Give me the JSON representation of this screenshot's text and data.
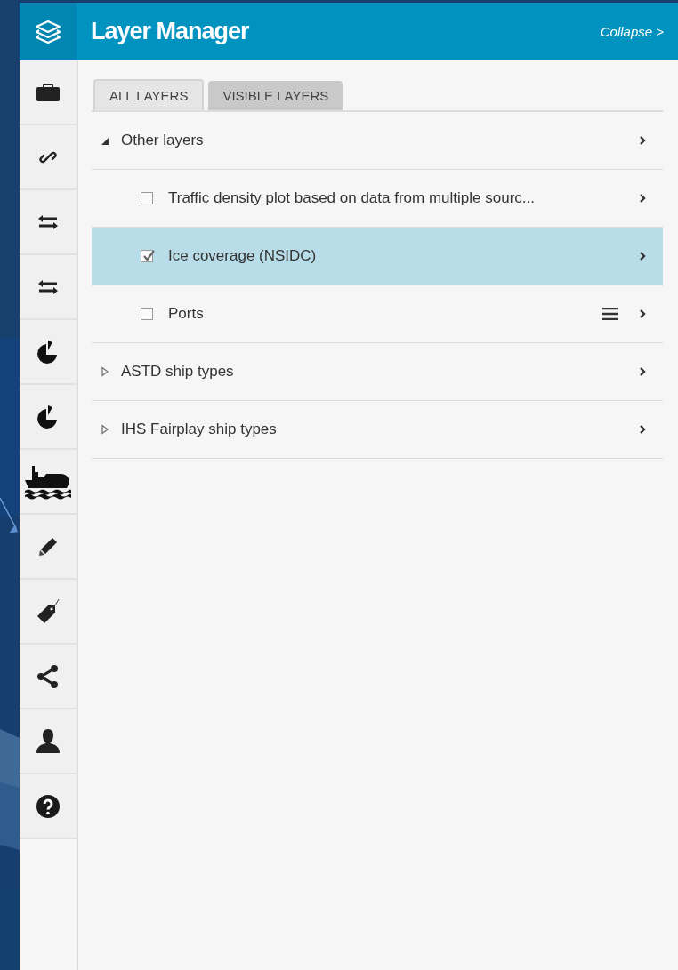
{
  "header": {
    "title": "Layer Manager",
    "collapse": "Collapse >"
  },
  "rail": [
    {
      "kind": "briefcase"
    },
    {
      "kind": "link"
    },
    {
      "kind": "swap"
    },
    {
      "kind": "swap"
    },
    {
      "kind": "pie"
    },
    {
      "kind": "pie"
    },
    {
      "kind": "ship"
    },
    {
      "kind": "pencil"
    },
    {
      "kind": "tag"
    },
    {
      "kind": "share"
    },
    {
      "kind": "person"
    },
    {
      "kind": "help"
    }
  ],
  "tabs": [
    {
      "label": "ALL LAYERS",
      "selected": true
    },
    {
      "label": "VISIBLE LAYERS",
      "selected": false
    }
  ],
  "tree": [
    {
      "label": "Other layers",
      "expanded": true,
      "children": [
        {
          "label": "Traffic density plot based on data from multiple sourc...",
          "checked": false,
          "selected": false,
          "menu": false
        },
        {
          "label": "Ice coverage (NSIDC)",
          "checked": true,
          "selected": true,
          "menu": false
        },
        {
          "label": "Ports",
          "checked": false,
          "selected": false,
          "menu": true
        }
      ]
    },
    {
      "label": "ASTD ship types",
      "expanded": false
    },
    {
      "label": "IHS Fairplay ship types",
      "expanded": false
    }
  ]
}
